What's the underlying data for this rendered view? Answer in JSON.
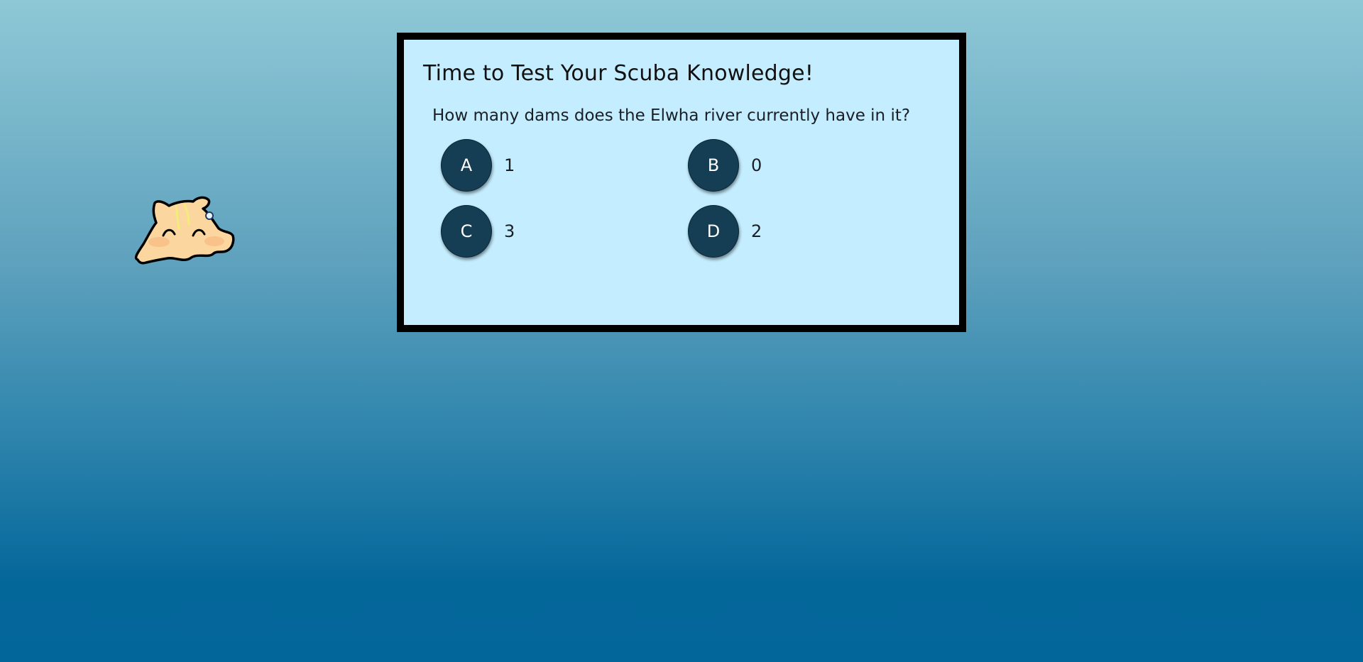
{
  "quiz": {
    "title": "Time to Test Your Scuba Knowledge!",
    "question": "How many dams does the Elwha river currently have in it?",
    "answers": [
      {
        "letter": "A",
        "text": "1"
      },
      {
        "letter": "B",
        "text": "0"
      },
      {
        "letter": "C",
        "text": "3"
      },
      {
        "letter": "D",
        "text": "2"
      }
    ]
  },
  "mascot": {
    "icon": "sea-slug-icon",
    "body_color": "#fbd79f",
    "blush_color": "#f7be86",
    "outline_color": "#000000"
  },
  "colors": {
    "panel_background": "#c4eeff",
    "panel_border": "#000000",
    "answer_button": "#153e54",
    "ocean_top": "#8ec8d6",
    "ocean_bottom": "#03669a"
  }
}
